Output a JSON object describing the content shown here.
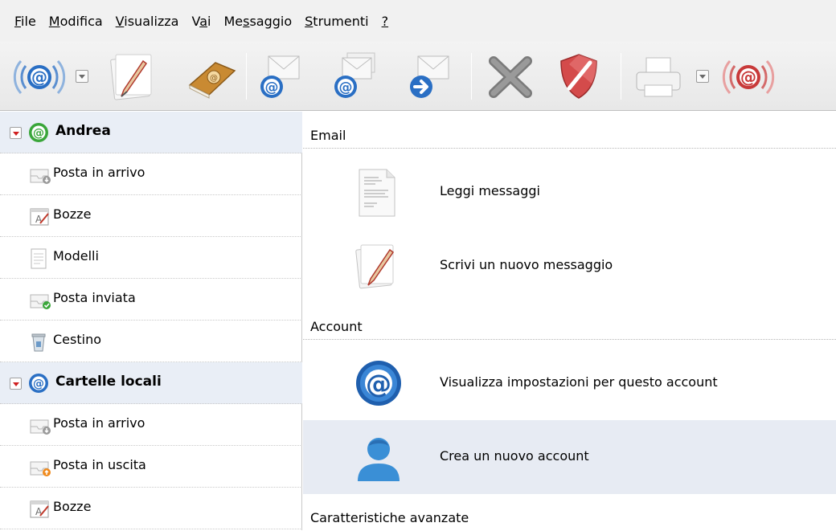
{
  "menubar": {
    "items": [
      {
        "key": "F",
        "rest": "ile"
      },
      {
        "key": "M",
        "rest": "odifica"
      },
      {
        "key": "V",
        "rest": "isualizza"
      },
      {
        "prefix": "V",
        "key": "a",
        "rest": "i"
      },
      {
        "prefix": "Me",
        "key": "s",
        "rest": "saggio"
      },
      {
        "key": "S",
        "rest": "trumenti"
      },
      {
        "key": "?",
        "rest": ""
      }
    ]
  },
  "toolbar": {
    "buttons": [
      {
        "name": "get-mail",
        "icon": "signal-at-icon"
      },
      {
        "name": "write",
        "icon": "pencil-paper-icon"
      },
      {
        "name": "address-book",
        "icon": "address-book-icon"
      },
      {
        "name": "reply",
        "icon": "reply-envelope-icon"
      },
      {
        "name": "reply-all",
        "icon": "reply-all-envelope-icon"
      },
      {
        "name": "forward",
        "icon": "forward-envelope-icon"
      },
      {
        "name": "delete",
        "icon": "delete-x-icon"
      },
      {
        "name": "junk",
        "icon": "junk-shield-icon"
      },
      {
        "name": "print",
        "icon": "printer-icon"
      },
      {
        "name": "stop",
        "icon": "stop-signal-icon"
      }
    ]
  },
  "folders": {
    "accounts": [
      {
        "name": "Andrea",
        "icon": "green-at-icon",
        "items": [
          {
            "label": "Posta in arrivo",
            "icon": "inbox-icon"
          },
          {
            "label": "Bozze",
            "icon": "drafts-icon"
          },
          {
            "label": "Modelli",
            "icon": "templates-icon"
          },
          {
            "label": "Posta inviata",
            "icon": "sent-icon"
          },
          {
            "label": "Cestino",
            "icon": "trash-icon"
          }
        ]
      },
      {
        "name": "Cartelle locali",
        "icon": "blue-at-icon",
        "items": [
          {
            "label": "Posta in arrivo",
            "icon": "inbox-icon"
          },
          {
            "label": "Posta in uscita",
            "icon": "outbox-icon"
          },
          {
            "label": "Bozze",
            "icon": "drafts-icon"
          }
        ]
      }
    ]
  },
  "content": {
    "sections": [
      {
        "title": "Email"
      },
      {
        "title": "Account"
      },
      {
        "title": "Caratteristiche avanzate"
      }
    ],
    "actions": [
      {
        "label": "Leggi messaggi",
        "icon": "document-icon"
      },
      {
        "label": "Scrivi un nuovo messaggio",
        "icon": "pencil-paper-icon"
      },
      {
        "label": "Visualizza impostazioni per questo account",
        "icon": "blue-at-icon"
      },
      {
        "label": "Crea un nuovo account",
        "icon": "user-icon"
      }
    ]
  },
  "colors": {
    "selected_row": "#e7ebf3",
    "account_row": "#e9eef6",
    "accent_blue": "#2a6fc4",
    "accent_red": "#c83a3a"
  }
}
